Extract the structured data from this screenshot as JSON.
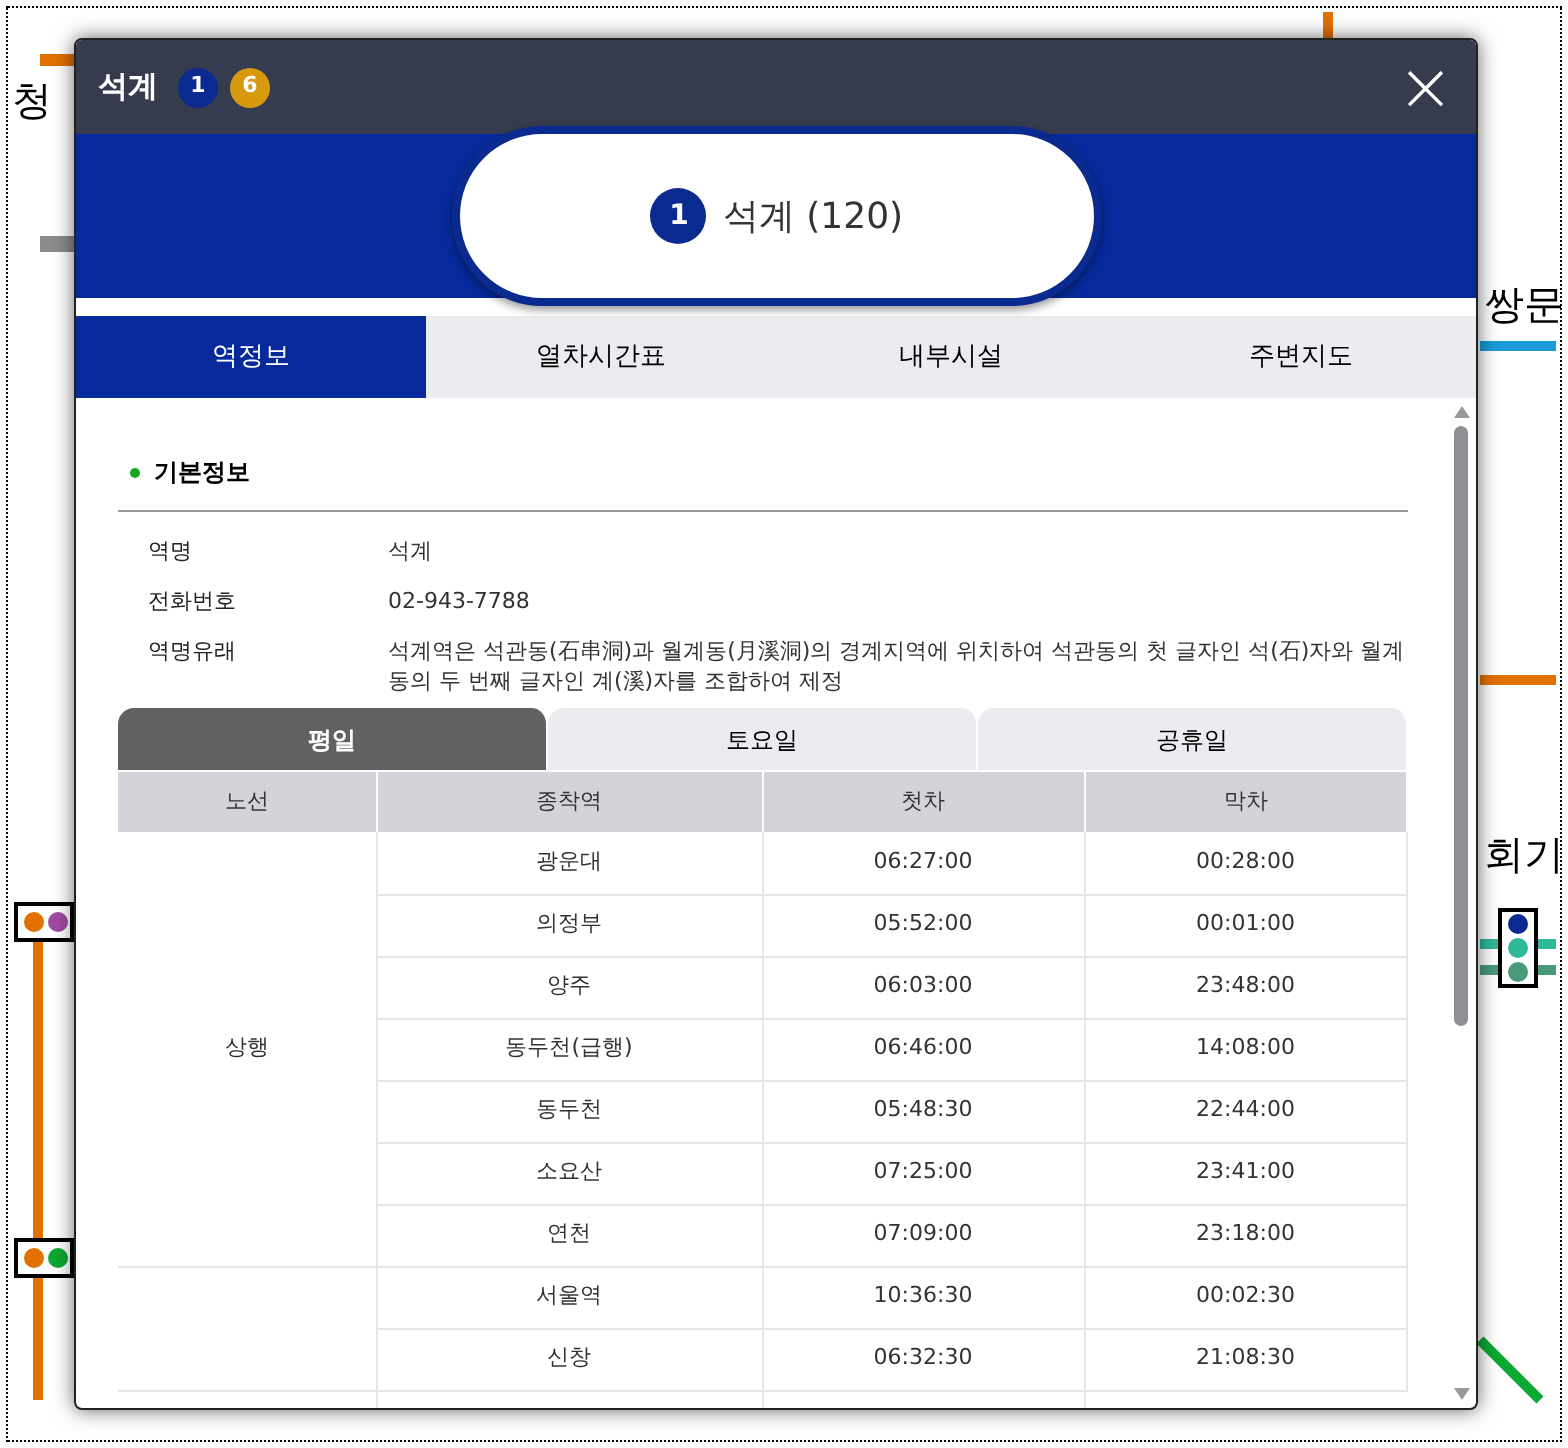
{
  "map_labels": [
    {
      "text": "청"
    },
    {
      "text": "쌍문"
    },
    {
      "text": "회기"
    }
  ],
  "window": {
    "title": "석계",
    "lines": [
      {
        "label": "1",
        "color": "#0b2a8f"
      },
      {
        "label": "6",
        "color": "#d8990f"
      }
    ],
    "close": "×"
  },
  "station": {
    "line": "1",
    "color": "#0b2a8f",
    "name": "석계 (120)"
  },
  "tabs": [
    {
      "label": "역정보",
      "selected": true
    },
    {
      "label": "열차시간표",
      "selected": false
    },
    {
      "label": "내부시설",
      "selected": false
    },
    {
      "label": "주변지도",
      "selected": false
    }
  ],
  "section_title": "기본정보",
  "info": [
    {
      "label": "역명",
      "value": "석계"
    },
    {
      "label": "전화번호",
      "value": "02-943-7788"
    },
    {
      "label": "역명유래",
      "value": "석계역은 석관동(石串洞)과 월계동(月溪洞)의 경계지역에 위치하여 석관동의 첫 글자인 석(石)자와 월계동의 두 번째 글자인 계(溪)자를 조합하여 제정"
    }
  ],
  "day_tabs": [
    {
      "label": "평일",
      "selected": true
    },
    {
      "label": "토요일",
      "selected": false
    },
    {
      "label": "공휴일",
      "selected": false
    }
  ],
  "table": {
    "columns": [
      "노선",
      "종착역",
      "첫차",
      "막차"
    ],
    "groups": [
      {
        "direction": "상행",
        "rows": [
          [
            "광운대",
            "06:27:00",
            "00:28:00"
          ],
          [
            "의정부",
            "05:52:00",
            "00:01:00"
          ],
          [
            "양주",
            "06:03:00",
            "23:48:00"
          ],
          [
            "동두천(급행)",
            "06:46:00",
            "14:08:00"
          ],
          [
            "동두천",
            "05:48:30",
            "22:44:00"
          ],
          [
            "소요산",
            "07:25:00",
            "23:41:00"
          ],
          [
            "연천",
            "07:09:00",
            "23:18:00"
          ]
        ]
      },
      {
        "rows": [
          [
            "서울역",
            "10:36:30",
            "00:02:30"
          ],
          [
            "신창",
            "06:32:30",
            "21:08:30"
          ]
        ]
      }
    ]
  }
}
